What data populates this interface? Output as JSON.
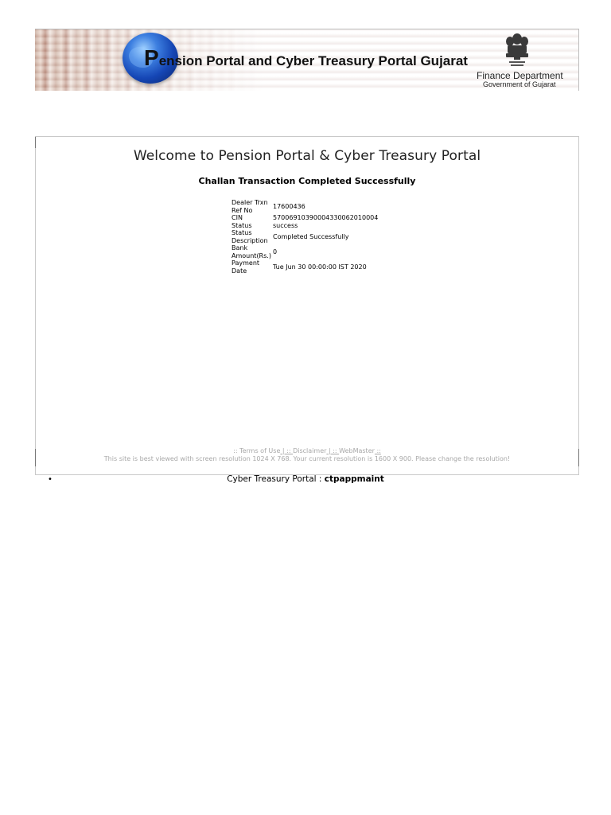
{
  "header": {
    "title_initial": "P",
    "title_rest": "ension Portal and Cyber Treasury Portal Gujarat",
    "department": "Finance Department",
    "government": "Government of Gujarat",
    "emblem_icon": "state-emblem-icon",
    "globe_icon": "globe-icon"
  },
  "main": {
    "welcome": "Welcome to Pension Portal & Cyber Treasury Portal",
    "subheading": "Challan Transaction Completed Successfully",
    "rows": [
      {
        "label": "Dealer Trxn Ref No",
        "value": "17600436"
      },
      {
        "label": "CIN",
        "value": "57006910390004330062010004"
      },
      {
        "label": "Status",
        "value": "success"
      },
      {
        "label": "Status Description",
        "value": "Completed Successfully"
      },
      {
        "label": "Bank Amount(Rs.)",
        "value": "0"
      },
      {
        "label": "Payment Date",
        "value": "Tue Jun 30 00:00:00 IST 2020"
      }
    ]
  },
  "footer": {
    "sep_open": ":: ",
    "terms": "Terms of Use",
    "pipe1": " | :: ",
    "disclaimer": "Disclaimer",
    "pipe2": " | :: ",
    "webmaster": "WebMaster",
    "sep_close": " :: ",
    "resolution_note": "This site is best viewed with screen resolution 1024 X 768. Your current resolution is 1600 X 900. Please change the resolution!"
  },
  "bottom": {
    "portal_label": "Cyber Treasury Portal : ",
    "server_name": "ctpappmaint"
  }
}
